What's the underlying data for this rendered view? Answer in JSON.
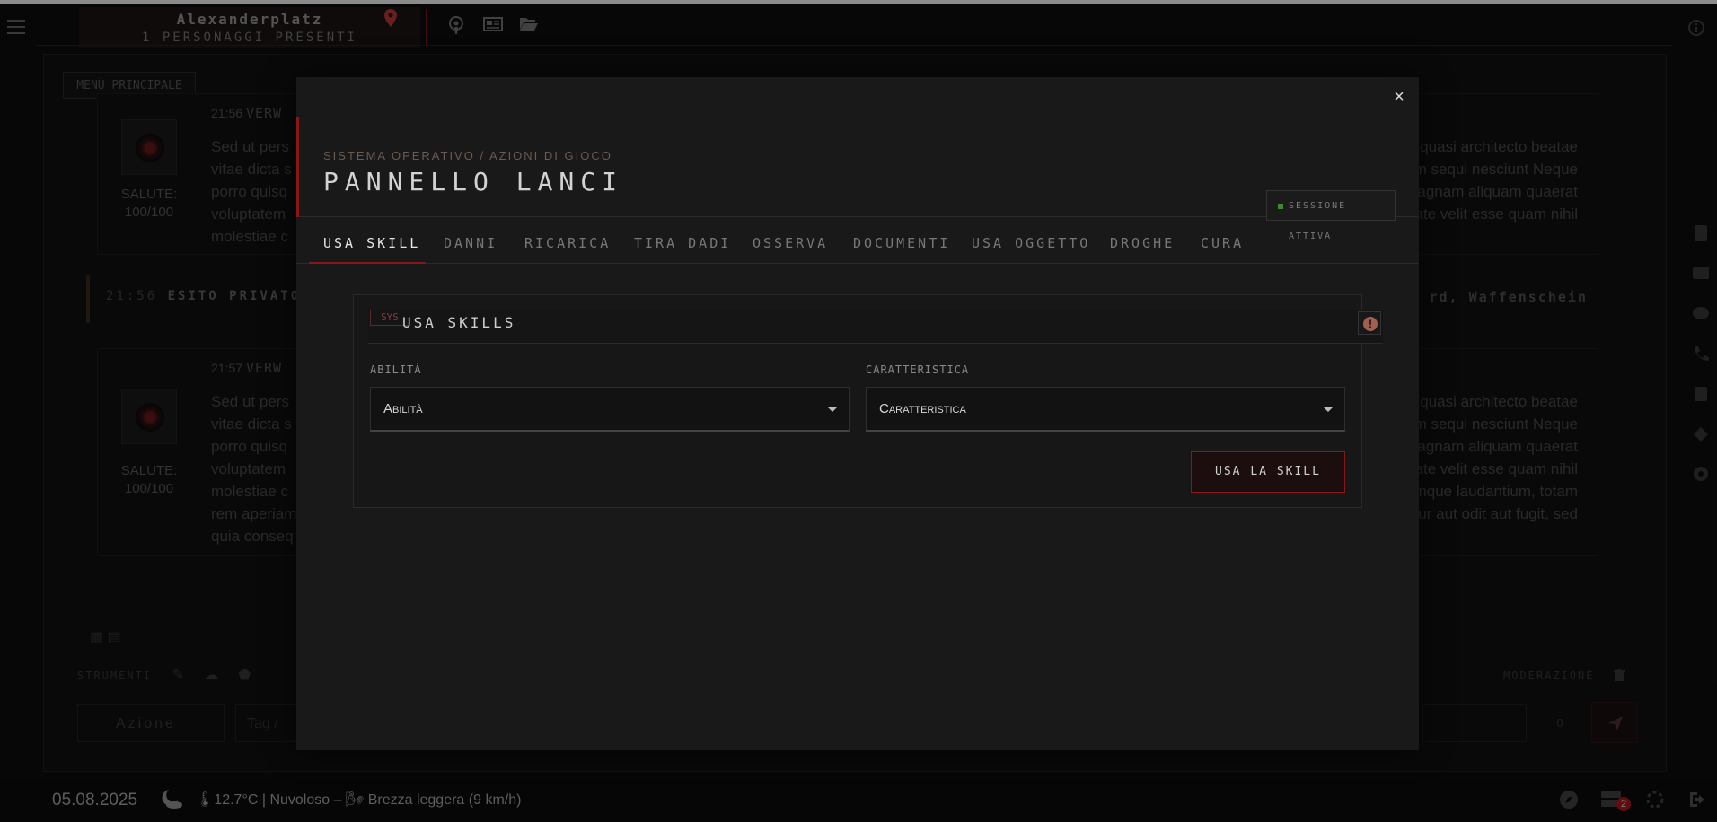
{
  "topbar": {
    "location_name": "Alexanderplatz",
    "present_count": "1 PERSONAGGI PRESENTI",
    "icons": [
      "menu-icon",
      "podcast-icon",
      "newspaper-icon",
      "folder-open-icon",
      "info-icon"
    ]
  },
  "background": {
    "menu_button": "MENÙ PRINCIPALE",
    "messages": [
      {
        "time": "21:56",
        "author": "VERW",
        "salute_label": "SALUTE:",
        "salute_value": "100/100",
        "left_lines": [
          "Sed ut pers",
          "vitae dicta s",
          "porro quisq",
          "voluptatem",
          "molestiae c"
        ],
        "right_lines": [
          "t quasi architecto beatae",
          "em sequi nesciunt Neque",
          "magnam aliquam quaerat",
          "ate velit esse quam nihil"
        ]
      },
      {
        "time": "21:57",
        "author": "VERW",
        "salute_label": "SALUTE:",
        "salute_value": "100/100",
        "left_lines": [
          "Sed ut pers",
          "vitae dicta s",
          "porro quisq",
          "voluptatem",
          "molestiae c",
          "rem aperiam",
          "quia conseq"
        ],
        "right_lines": [
          "t quasi architecto beatae",
          "em sequi nesciunt Neque",
          "magnam aliquam quaerat",
          "ate velit esse quam nihil",
          "emque laudantium, totam",
          "tur aut odit aut fugit, sed"
        ]
      }
    ],
    "esito": {
      "time": "21:56",
      "label": "ESITO PRIVATO",
      "right_text": "rd, Waffenschein"
    },
    "toolbar": {
      "strumenti": "STRUMENTI",
      "moderazione": "MODERAZIONE",
      "azione": "Azione",
      "tag": "Tag /",
      "counter": "0"
    }
  },
  "bottombar": {
    "date": "05.08.2025",
    "weather": "🌡12.7°C | Nuvoloso – 🌬 Brezza leggera (9 km/h)",
    "badge_count": "2"
  },
  "modal": {
    "close_label": "×",
    "subtitle": "SISTEMA OPERATIVO / AZIONI DI GIOCO",
    "title": "PANNELLO LANCI",
    "session_label": "SESSIONE ATTIVA",
    "tabs": [
      {
        "label": "USA SKILL",
        "active": true
      },
      {
        "label": "DANNI"
      },
      {
        "label": "RICARICA"
      },
      {
        "label": "TIRA DADI"
      },
      {
        "label": "OSSERVA"
      },
      {
        "label": "DOCUMENTI"
      },
      {
        "label": "USA OGGETTO"
      },
      {
        "label": "DROGHE"
      },
      {
        "label": "CURA"
      }
    ],
    "panel": {
      "sys_tag": "SYS",
      "heading": "USA SKILLS",
      "abilita_label": "ABILITÀ",
      "abilita_value": "Abilità",
      "caratteristica_label": "CARATTERISTICA",
      "caratteristica_value": "Caratteristica",
      "submit_label": "USA LA SKILL"
    }
  },
  "colors": {
    "accent": "#8a1717",
    "active_session": "#3d8a2e",
    "background": "#0e0e0e",
    "modal": "#191919"
  }
}
